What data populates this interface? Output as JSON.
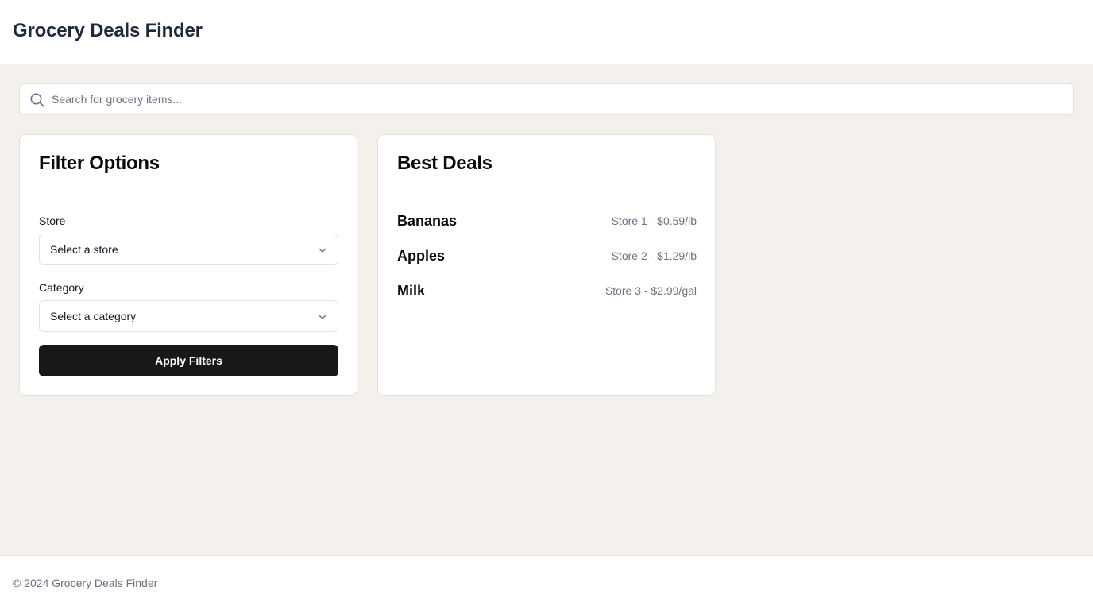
{
  "header": {
    "title": "Grocery Deals Finder"
  },
  "search": {
    "placeholder": "Search for grocery items...",
    "value": "",
    "icon": "search-icon"
  },
  "filters": {
    "title": "Filter Options",
    "store": {
      "label": "Store",
      "selected": "Select a store",
      "icon": "chevron-down-icon"
    },
    "category": {
      "label": "Category",
      "selected": "Select a category",
      "icon": "chevron-down-icon"
    },
    "apply_label": "Apply Filters"
  },
  "deals": {
    "title": "Best Deals",
    "items": [
      {
        "name": "Bananas",
        "info": "Store 1 - $0.59/lb"
      },
      {
        "name": "Apples",
        "info": "Store 2 - $1.29/lb"
      },
      {
        "name": "Milk",
        "info": "Store 3 - $2.99/gal"
      }
    ]
  },
  "footer": {
    "text": "© 2024 Grocery Deals Finder"
  },
  "colors": {
    "background": "#f4f1ec",
    "surface": "#ffffff",
    "primary_button": "#18181b",
    "muted_text": "#6b7280",
    "border": "#e5e2dd"
  }
}
